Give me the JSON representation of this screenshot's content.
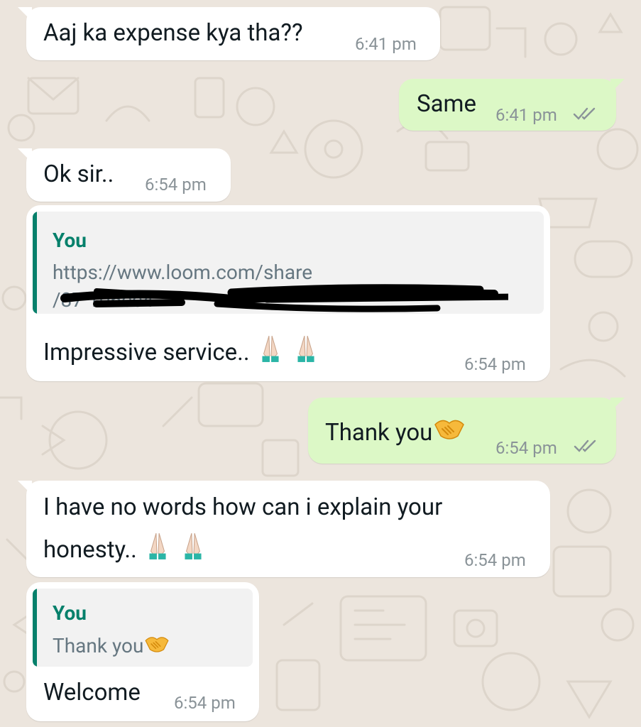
{
  "chat": {
    "messages": [
      {
        "direction": "incoming",
        "text": "Aaj ka expense kya tha??",
        "time": "6:41 pm"
      },
      {
        "direction": "outgoing",
        "text": "Same",
        "time": "6:41 pm",
        "status": "read-double-tick"
      },
      {
        "direction": "incoming",
        "text": "Ok sir..",
        "time": "6:54 pm"
      },
      {
        "direction": "incoming",
        "quote": {
          "author": "You",
          "line1": "https://www.loom.com/share",
          "line2": "/87        106ce4"
        },
        "text": "Impressive service..",
        "emoji": [
          "folded-hands",
          "folded-hands"
        ],
        "time": "6:54 pm"
      },
      {
        "direction": "outgoing",
        "text": "Thank you",
        "emoji": [
          "handshake"
        ],
        "time": "6:54 pm",
        "status": "read-double-tick"
      },
      {
        "direction": "incoming",
        "line1": "I have no words how can i explain your",
        "line2": "honesty..",
        "emoji": [
          "folded-hands",
          "folded-hands"
        ],
        "time": "6:54 pm"
      },
      {
        "direction": "incoming",
        "quote": {
          "author": "You",
          "text": "Thank you",
          "emoji": [
            "handshake"
          ]
        },
        "text": "Welcome",
        "time": "6:54 pm"
      }
    ]
  },
  "colors": {
    "background": "#ece5dd",
    "incoming_bubble": "#ffffff",
    "outgoing_bubble": "#dcf8c6",
    "quote_accent": "#06806b",
    "timestamp": "#8a9398"
  }
}
